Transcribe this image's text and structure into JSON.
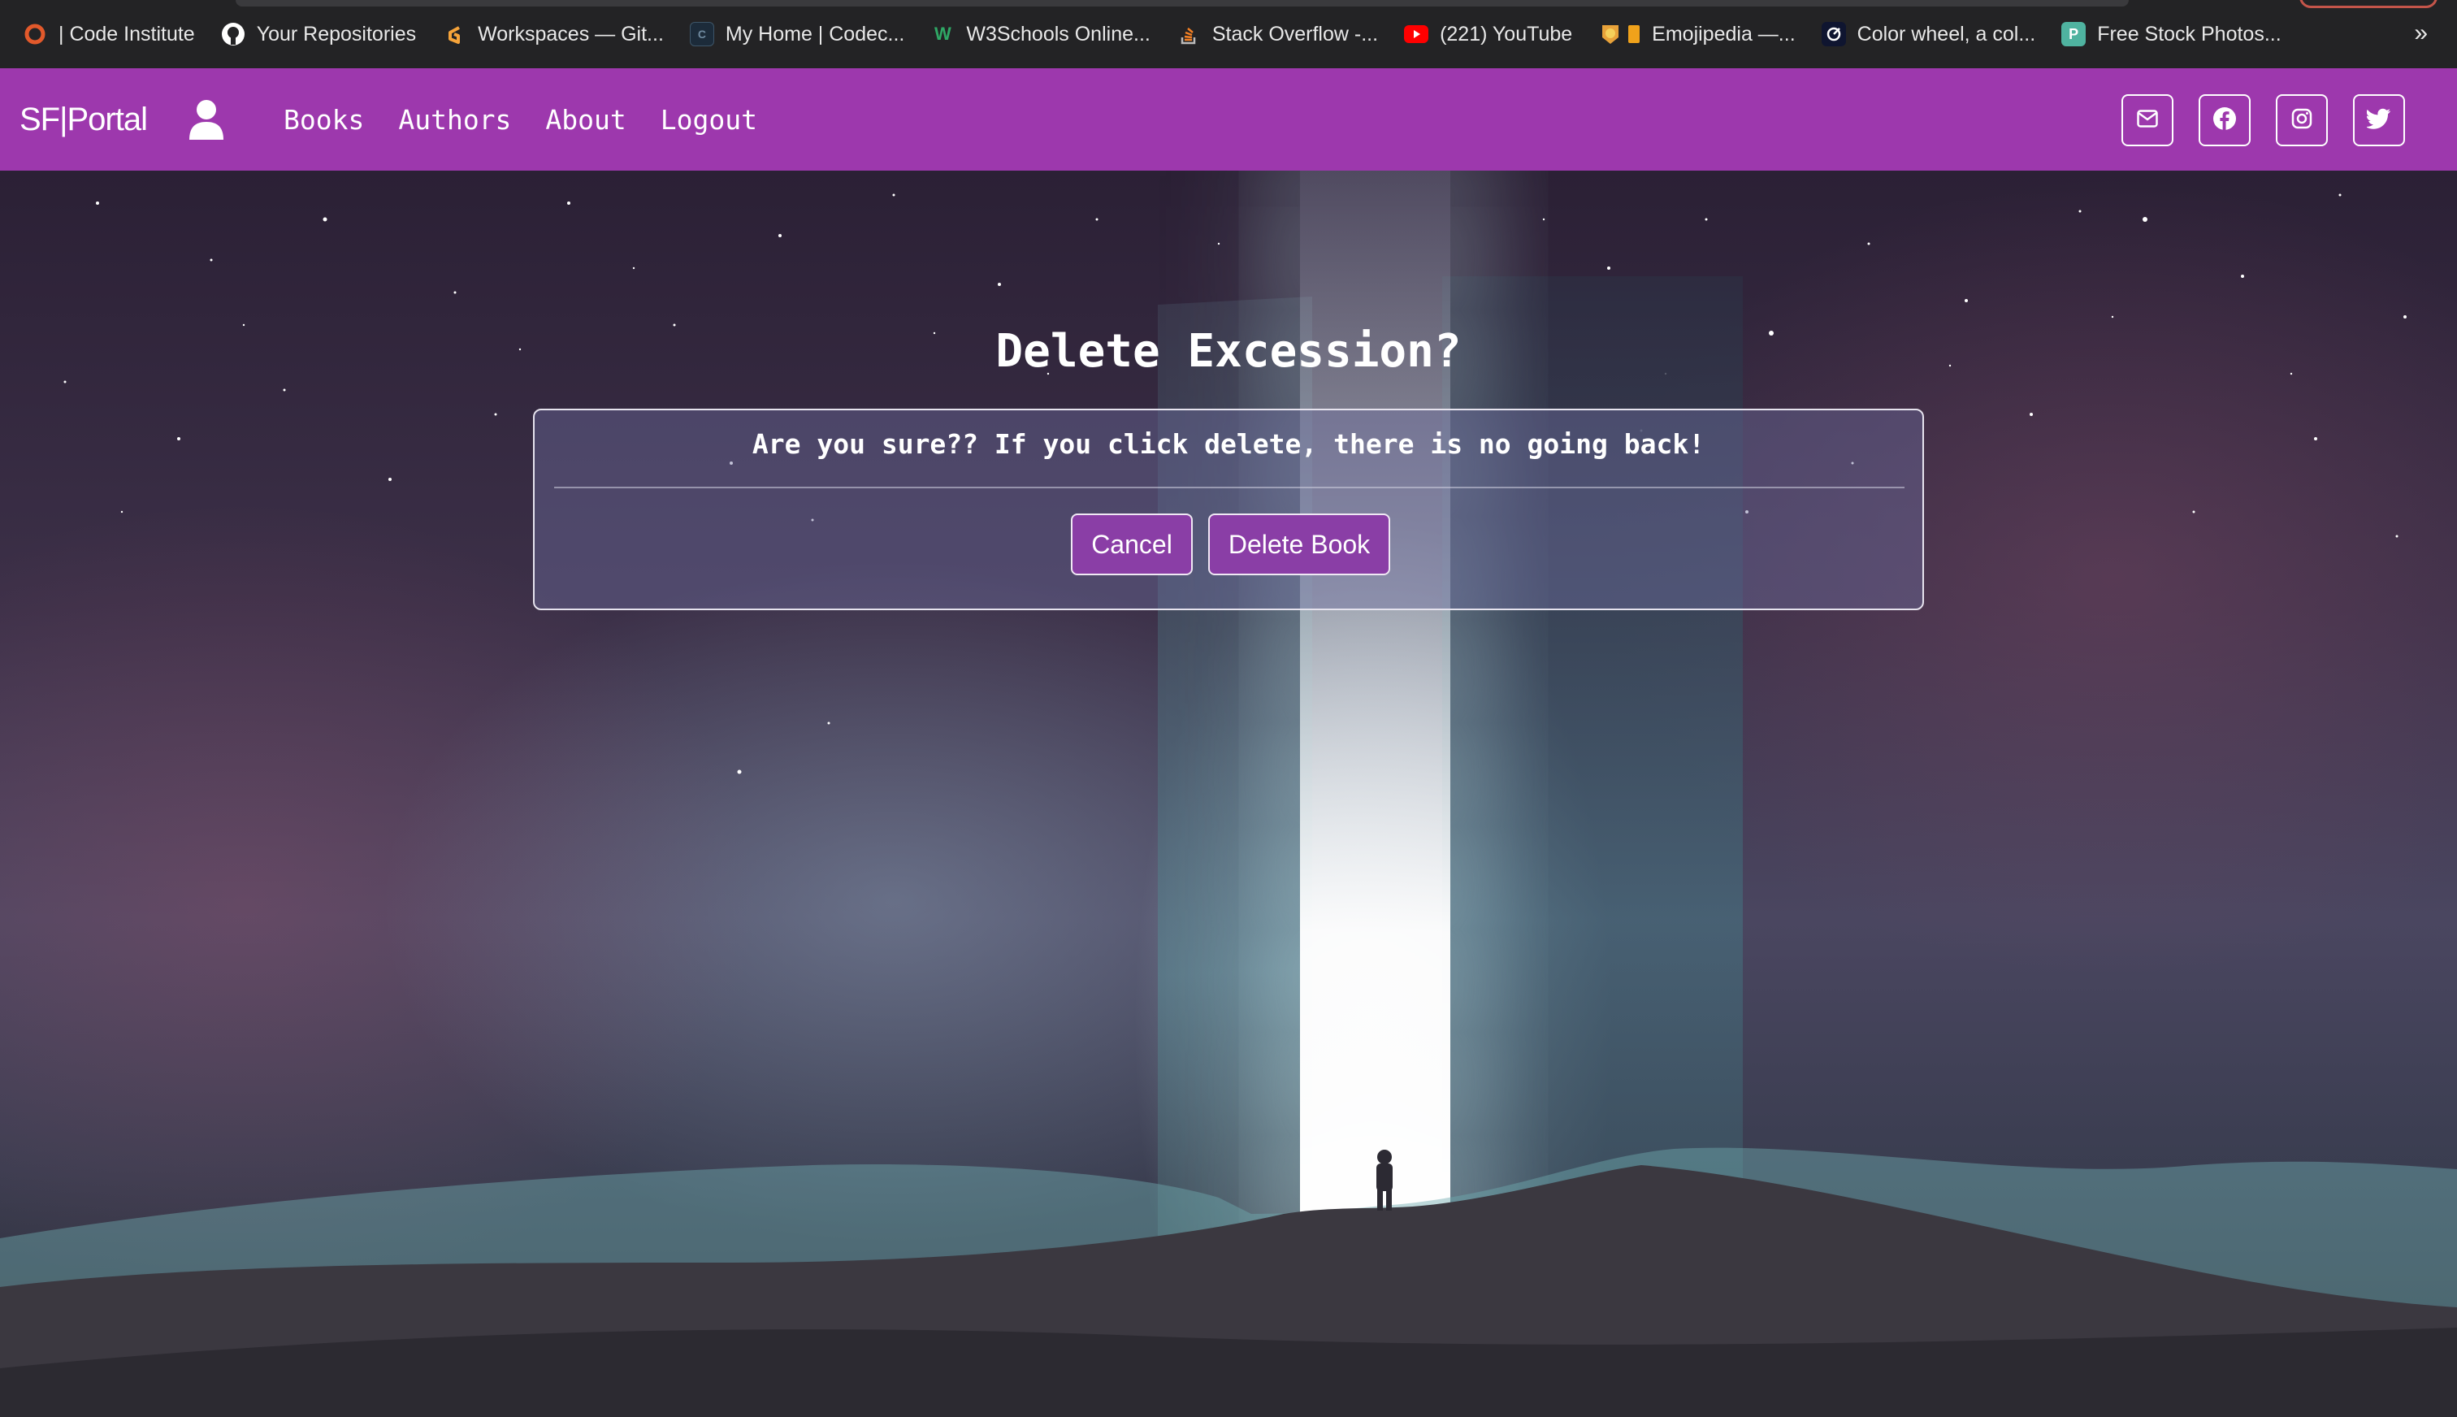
{
  "bookmarks": {
    "items": [
      {
        "label": "| Code Institute",
        "icon": "code-institute-icon"
      },
      {
        "label": "Your Repositories",
        "icon": "github-icon"
      },
      {
        "label": "Workspaces — Git...",
        "icon": "gitpod-icon"
      },
      {
        "label": "My Home | Codec...",
        "icon": "codecademy-icon"
      },
      {
        "label": "W3Schools Online...",
        "icon": "w3schools-icon"
      },
      {
        "label": "Stack Overflow -...",
        "icon": "stackoverflow-icon"
      },
      {
        "label": "(221) YouTube",
        "icon": "youtube-icon"
      },
      {
        "label": "Emojipedia —...",
        "icon": "emojipedia-icon"
      },
      {
        "label": "Color wheel, a col...",
        "icon": "colorwheel-icon"
      },
      {
        "label": "Free Stock Photos...",
        "icon": "pexels-icon"
      }
    ],
    "more": "»"
  },
  "navbar": {
    "brand": "SF|Portal",
    "links": {
      "books": "Books",
      "authors": "Authors",
      "about": "About",
      "logout": "Logout"
    },
    "social": [
      "envelope-icon",
      "facebook-icon",
      "instagram-icon",
      "twitter-icon"
    ],
    "color": "#9d38ad"
  },
  "content": {
    "title": "Delete Excession?",
    "message": "Are you sure?? If you click delete, there is no going back!",
    "cancel_label": "Cancel",
    "delete_label": "Delete Book",
    "button_color": "#8a3ea6"
  }
}
